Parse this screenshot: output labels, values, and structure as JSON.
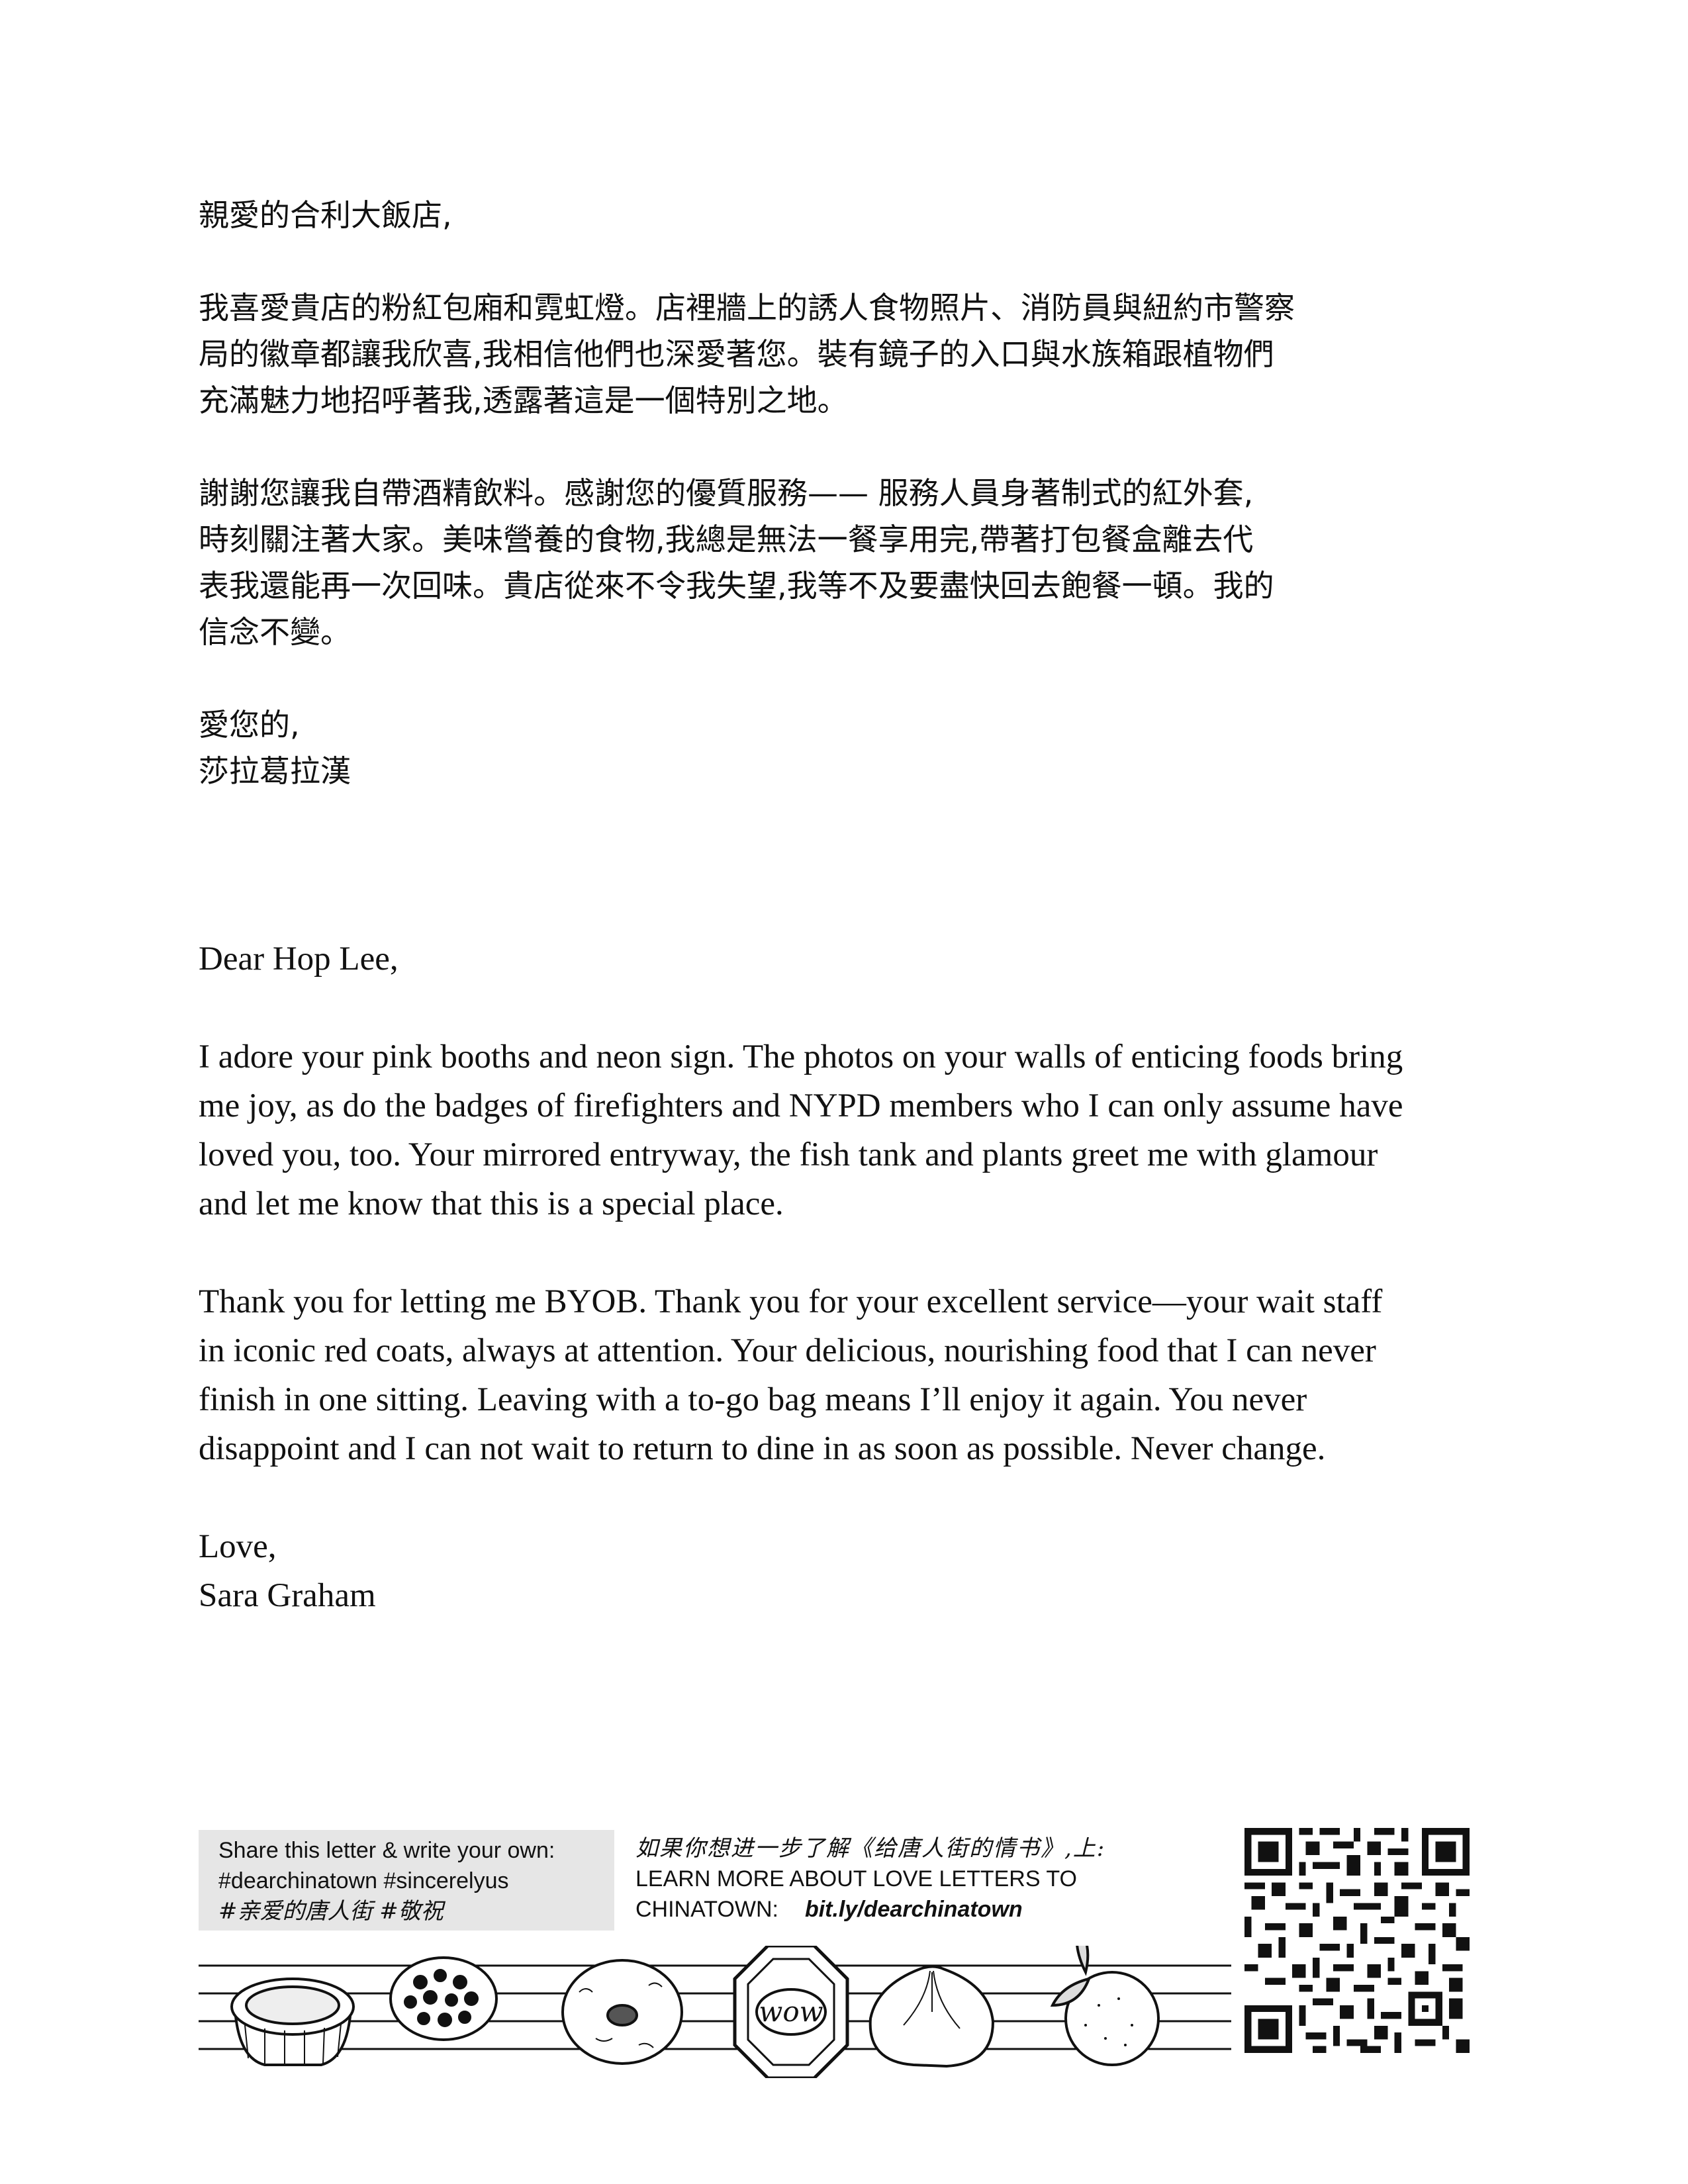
{
  "zh_letter": {
    "salutation": "親愛的合利大飯店,",
    "p1_lines": [
      "我喜愛貴店的粉紅包廂和霓虹燈。店裡牆上的誘人食物照片、消防員與紐約市警察",
      "局的徽章都讓我欣喜,我相信他們也深愛著您。裝有鏡子的入口與水族箱跟植物們",
      "充滿魅力地招呼著我,透露著這是一個特別之地。"
    ],
    "p2_lines": [
      "謝謝您讓我自帶酒精飲料。感謝您的優質服務—— 服務人員身著制式的紅外套,",
      "時刻關注著大家。美味營養的食物,我總是無法一餐享用完,帶著打包餐盒離去代",
      "表我還能再一次回味。貴店從來不令我失望,我等不及要盡快回去飽餐一頓。我的",
      "信念不變。"
    ],
    "closing": "愛您的,",
    "signature": "莎拉葛拉漢"
  },
  "en_letter": {
    "salutation": "Dear Hop Lee,",
    "p1_lines": [
      "I adore your pink booths and neon sign. The photos on your walls of enticing foods bring",
      "me joy, as do the badges of firefighters and NYPD members who I can only assume have",
      "loved you, too. Your mirrored entryway, the fish tank and plants greet me with glamour",
      "and let me know that this is a special place."
    ],
    "p2_lines": [
      "Thank you for letting me BYOB. Thank you for your excellent service—your wait staff",
      "in iconic red coats, always at attention. Your delicious, nourishing food that I can never",
      "finish in one sitting. Leaving with a to-go bag means I’ll enjoy it again. You never",
      "disappoint and I can not wait to return to dine in as soon as possible. Never change."
    ],
    "closing": "Love,",
    "signature": "Sara Graham"
  },
  "footer": {
    "share_line": "Share this letter & write your own:",
    "hashtags_en": "#dearchinatown #sincerelyus",
    "hashtags_zh": "#亲爱的唐人街 #敬祝",
    "learn_zh": "如果你想进一步了解《给唐人街的情书》,上:",
    "learn_en_1": "LEARN MORE ABOUT LOVE LETTERS TO",
    "learn_en_2": "CHINATOWN:",
    "link": "bit.ly/dearchinatown",
    "badge_text": "wow"
  }
}
